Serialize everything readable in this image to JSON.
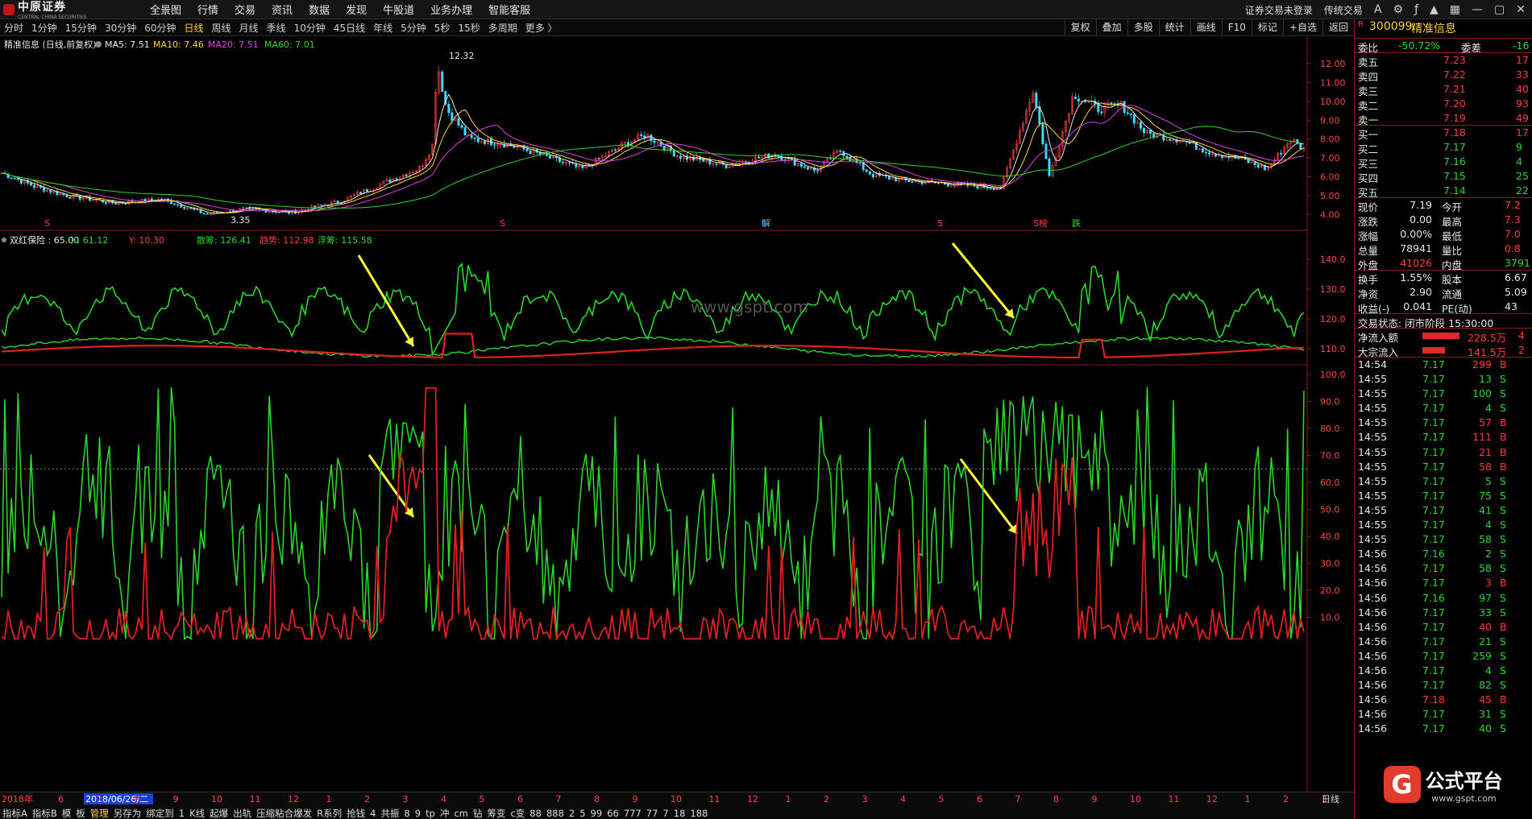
{
  "menubar": {
    "logo": "中原证券",
    "logo_sub": "CENTRAL CHINA SECURITIES",
    "items": [
      "全景图",
      "行情",
      "交易",
      "资讯",
      "数据",
      "发现",
      "牛股道",
      "业务办理",
      "智能客服"
    ],
    "right": [
      "证券交易未登录",
      "传统交易"
    ],
    "icons": [
      "font-size-icon",
      "settings-icon",
      "formula-icon",
      "shirt-icon",
      "skin-icon",
      "grid-icon",
      "minimize-icon",
      "maximize-icon",
      "close-icon"
    ]
  },
  "periods": [
    "分时",
    "1分钟",
    "15分钟",
    "30分钟",
    "60分钟",
    "日线",
    "周线",
    "月线",
    "季线",
    "10分钟",
    "45日线",
    "年线",
    "5分钟",
    "5秒",
    "15秒",
    "多周期",
    "更多 〉"
  ],
  "period_active": "日线",
  "period_right": [
    "复权",
    "叠加",
    "多股",
    "统计",
    "画线",
    "F10",
    "标记",
    "+自选",
    "返回"
  ],
  "price_panel": {
    "title": "精准信息 (日线,前复权)",
    "ma": [
      {
        "name": "MA5",
        "label": "MA5: 7.51",
        "color": "#e8e8e8"
      },
      {
        "name": "MA10",
        "label": "MA10: 7.46",
        "color": "#ffd43b"
      },
      {
        "name": "MA20",
        "label": "MA20: 7.51",
        "color": "#e040e0"
      },
      {
        "name": "MA60",
        "label": "MA60: 7.01",
        "color": "#2bd62b"
      }
    ],
    "high_label": "12.32",
    "low_label": "3.35",
    "axis": [
      "12.00",
      "11.00",
      "10.00",
      "9.00",
      "8.00",
      "7.00",
      "6.00",
      "5.00",
      "4.00"
    ],
    "markers": [
      {
        "text": "S",
        "color": "#ff3b3b"
      },
      {
        "text": "S",
        "color": "#ff3b3b"
      },
      {
        "text": "解",
        "color": "#58c8ff"
      },
      {
        "text": "S",
        "color": "#ff3b3b"
      },
      {
        "text": "S榜",
        "color": "#ff3b3b"
      },
      {
        "text": "跌",
        "color": "#2bd62b"
      }
    ]
  },
  "ind1": {
    "title": "双红保险 : 65.00",
    "x": "X: 61.12",
    "y": "Y: 10.30",
    "sanchou": "散筹: 126.41",
    "qushi": "趋势: 112.98",
    "fuchou": "浮筹: 115.58",
    "axis": [
      "140.0",
      "130.0",
      "120.0",
      "110.0"
    ]
  },
  "ind2": {
    "axis": [
      "100.0",
      "90.0",
      "80.0",
      "70.0",
      "60.0",
      "50.0",
      "40.0",
      "30.0",
      "20.0",
      "10.0"
    ]
  },
  "watermark_center": "www.gspt.com",
  "timeline": {
    "year": "2018年",
    "sel": "2018/06/26/二",
    "months": [
      "6",
      "7",
      "8",
      "9",
      "10",
      "11",
      "12",
      "1",
      "2",
      "3",
      "4",
      "5",
      "6",
      "7",
      "8",
      "9",
      "10",
      "11",
      "12",
      "1",
      "2",
      "3",
      "4",
      "5",
      "6",
      "7",
      "8",
      "9",
      "10",
      "11",
      "12",
      "1",
      "2",
      "3"
    ],
    "right": "日线"
  },
  "indicator_bar": [
    "指标A",
    "指标B",
    "模",
    "板",
    "管理",
    "另存为",
    "绑定到",
    "1",
    "K线",
    "起爆",
    "出轨",
    "压缩粘合爆发",
    "R系列",
    "抢钱",
    "4",
    "共振",
    "8",
    "9",
    "tp",
    "冲",
    "cm",
    "钻",
    "筹变",
    "c变",
    "88",
    "888",
    "2",
    "5",
    "99",
    "66",
    "777",
    "77",
    "7",
    "18",
    "188"
  ],
  "indicator_active": "管理",
  "quote": {
    "code": "300099",
    "name": "精准信息",
    "weibi_label": "委比",
    "weibi": "-50.72%",
    "weicha_label": "委差",
    "weicha": "-16",
    "sells": [
      {
        "label": "卖五",
        "price": "7.23",
        "vol": "17"
      },
      {
        "label": "卖四",
        "price": "7.22",
        "vol": "33"
      },
      {
        "label": "卖三",
        "price": "7.21",
        "vol": "40"
      },
      {
        "label": "卖二",
        "price": "7.20",
        "vol": "93"
      },
      {
        "label": "卖一",
        "price": "7.19",
        "vol": "49"
      }
    ],
    "buys": [
      {
        "label": "买一",
        "price": "7.18",
        "vol": "17"
      },
      {
        "label": "买二",
        "price": "7.17",
        "vol": "9"
      },
      {
        "label": "买三",
        "price": "7.16",
        "vol": "4"
      },
      {
        "label": "买四",
        "price": "7.15",
        "vol": "25"
      },
      {
        "label": "买五",
        "price": "7.14",
        "vol": "22"
      }
    ],
    "stats": [
      {
        "l1": "现价",
        "v1": "7.19",
        "l2": "今开",
        "v2": "7.2"
      },
      {
        "l1": "涨跌",
        "v1": "0.00",
        "l2": "最高",
        "v2": "7.3"
      },
      {
        "l1": "涨幅",
        "v1": "0.00%",
        "l2": "最低",
        "v2": "7.0"
      },
      {
        "l1": "总量",
        "v1": "78941",
        "l2": "量比",
        "v2": "0.8"
      },
      {
        "l1": "外盘",
        "v1": "41026",
        "l2": "内盘",
        "v2": "3791"
      }
    ],
    "stats2": [
      {
        "l1": "换手",
        "v1": "1.55%",
        "l2": "股本",
        "v2": "6.67"
      },
      {
        "l1": "净资",
        "v1": "2.90",
        "l2": "流通",
        "v2": "5.09"
      },
      {
        "l1": "收益(-)",
        "v1": "0.041",
        "l2": "PE(动)",
        "v2": "43"
      }
    ],
    "status": "交易状态: 闭市阶段 15:30:00",
    "flows": [
      {
        "label": "净流入额",
        "value": "228.5万",
        "extra": "4"
      },
      {
        "label": "大宗流入",
        "value": "141.5万",
        "extra": "2"
      }
    ],
    "ticks": [
      [
        "14:54",
        "7.17",
        "299",
        "B"
      ],
      [
        "14:55",
        "7.17",
        "13",
        "S"
      ],
      [
        "14:55",
        "7.17",
        "100",
        "S"
      ],
      [
        "14:55",
        "7.17",
        "4",
        "S"
      ],
      [
        "14:55",
        "7.17",
        "57",
        "B"
      ],
      [
        "14:55",
        "7.17",
        "111",
        "B"
      ],
      [
        "14:55",
        "7.17",
        "21",
        "B"
      ],
      [
        "14:55",
        "7.17",
        "58",
        "B"
      ],
      [
        "14:55",
        "7.17",
        "5",
        "S"
      ],
      [
        "14:55",
        "7.17",
        "75",
        "S"
      ],
      [
        "14:55",
        "7.17",
        "41",
        "S"
      ],
      [
        "14:55",
        "7.17",
        "4",
        "S"
      ],
      [
        "14:55",
        "7.17",
        "58",
        "S"
      ],
      [
        "14:56",
        "7.16",
        "2",
        "S"
      ],
      [
        "14:56",
        "7.17",
        "58",
        "S"
      ],
      [
        "14:56",
        "7.17",
        "3",
        "B"
      ],
      [
        "14:56",
        "7.16",
        "97",
        "S"
      ],
      [
        "14:56",
        "7.17",
        "33",
        "S"
      ],
      [
        "14:56",
        "7.17",
        "40",
        "B"
      ],
      [
        "14:56",
        "7.17",
        "21",
        "S"
      ],
      [
        "14:56",
        "7.17",
        "259",
        "S"
      ],
      [
        "14:56",
        "7.17",
        "4",
        "S"
      ],
      [
        "14:56",
        "7.17",
        "82",
        "S"
      ],
      [
        "14:56",
        "7.18",
        "45",
        "B"
      ],
      [
        "14:56",
        "7.17",
        "31",
        "S"
      ],
      [
        "14:56",
        "7.17",
        "40",
        "S"
      ]
    ]
  },
  "brand": {
    "title": "公式平台",
    "url": "www.gspt.com"
  },
  "colors": {
    "up": "#ff3b3b",
    "down": "#2bd62b",
    "grid": "#5a1010",
    "arrow": "#ffff33"
  }
}
